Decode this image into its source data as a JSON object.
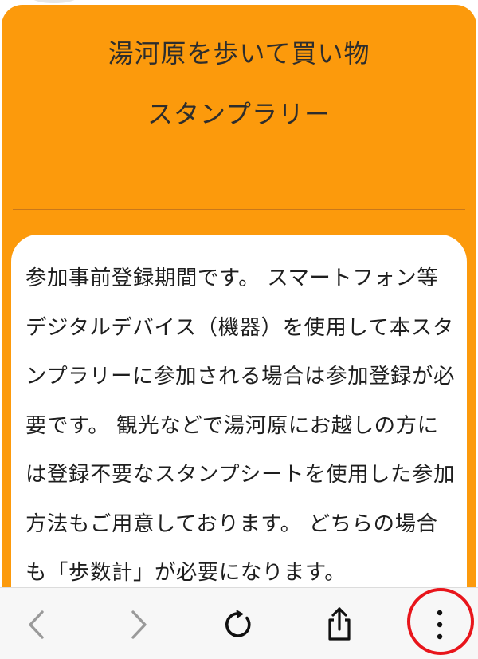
{
  "page": {
    "title_line1": "湯河原を歩いて買い物",
    "title_line2": "スタンプラリー",
    "notice": "参加事前登録期間です。 スマートフォン等デジタルデバイス（機器）を使用して本スタンプラリーに参加される場合は参加登録が必要です。 観光などで湯河原にお越しの方には登録不要なスタンプシートを使用した参加方法もご用意しております。 どちらの場合も「歩数計」が必要になります。"
  },
  "toolbar": {
    "items": [
      {
        "icon": "chevron-left-icon",
        "state": "disabled"
      },
      {
        "icon": "chevron-right-icon",
        "state": "disabled"
      },
      {
        "icon": "reload-icon",
        "state": "enabled"
      },
      {
        "icon": "share-icon",
        "state": "enabled"
      },
      {
        "icon": "more-vertical-icon",
        "state": "enabled",
        "highlighted": true
      }
    ]
  },
  "colors": {
    "header_background": "#fc9a0c",
    "content_background": "#ffffff",
    "text": "#1e1e1e",
    "toolbar_background": "#f7f7f7",
    "icon_disabled": "#9a9a9a",
    "icon_enabled": "#111111",
    "highlight_ring": "#e8151b"
  }
}
